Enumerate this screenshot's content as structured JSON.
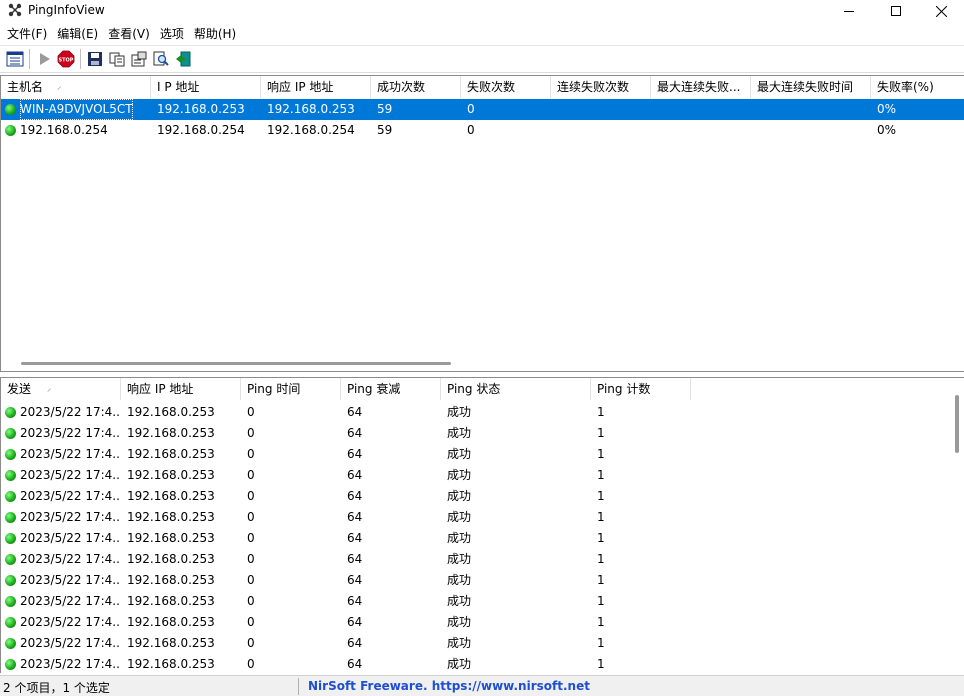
{
  "window": {
    "title": "PingInfoView"
  },
  "menu": [
    "文件(F)",
    "编辑(E)",
    "查看(V)",
    "选项",
    "帮助(H)"
  ],
  "upper": {
    "columns": [
      "主机名",
      "I P 地址",
      "响应 IP 地址",
      "成功次数",
      "失败次数",
      "连续失败次数",
      "最大连续失败...",
      "最大连续失败时间",
      "失败率(%)"
    ],
    "rows": [
      {
        "host": "WIN-A9DVJVOL5CT",
        "ip": "192.168.0.253",
        "reply_ip": "192.168.0.253",
        "succeed": "59",
        "failed": "0",
        "consec_failed": "",
        "max_consec": "",
        "max_consec_time": "",
        "failed_pct": "0%"
      },
      {
        "host": "192.168.0.254",
        "ip": "192.168.0.254",
        "reply_ip": "192.168.0.254",
        "succeed": "59",
        "failed": "0",
        "consec_failed": "",
        "max_consec": "",
        "max_consec_time": "",
        "failed_pct": "0%"
      }
    ]
  },
  "lower": {
    "columns": [
      "发送",
      "响应 IP 地址",
      "Ping 时间",
      "Ping 衰减",
      "Ping 状态",
      "Ping 计数"
    ],
    "rows": [
      {
        "sent": "2023/5/22 17:4...",
        "reply_ip": "192.168.0.253",
        "time": "0",
        "ttl": "64",
        "status": "成功",
        "count": "1"
      },
      {
        "sent": "2023/5/22 17:4...",
        "reply_ip": "192.168.0.253",
        "time": "0",
        "ttl": "64",
        "status": "成功",
        "count": "1"
      },
      {
        "sent": "2023/5/22 17:4...",
        "reply_ip": "192.168.0.253",
        "time": "0",
        "ttl": "64",
        "status": "成功",
        "count": "1"
      },
      {
        "sent": "2023/5/22 17:4...",
        "reply_ip": "192.168.0.253",
        "time": "0",
        "ttl": "64",
        "status": "成功",
        "count": "1"
      },
      {
        "sent": "2023/5/22 17:4...",
        "reply_ip": "192.168.0.253",
        "time": "0",
        "ttl": "64",
        "status": "成功",
        "count": "1"
      },
      {
        "sent": "2023/5/22 17:4...",
        "reply_ip": "192.168.0.253",
        "time": "0",
        "ttl": "64",
        "status": "成功",
        "count": "1"
      },
      {
        "sent": "2023/5/22 17:4...",
        "reply_ip": "192.168.0.253",
        "time": "0",
        "ttl": "64",
        "status": "成功",
        "count": "1"
      },
      {
        "sent": "2023/5/22 17:4...",
        "reply_ip": "192.168.0.253",
        "time": "0",
        "ttl": "64",
        "status": "成功",
        "count": "1"
      },
      {
        "sent": "2023/5/22 17:4...",
        "reply_ip": "192.168.0.253",
        "time": "0",
        "ttl": "64",
        "status": "成功",
        "count": "1"
      },
      {
        "sent": "2023/5/22 17:4...",
        "reply_ip": "192.168.0.253",
        "time": "0",
        "ttl": "64",
        "status": "成功",
        "count": "1"
      },
      {
        "sent": "2023/5/22 17:4...",
        "reply_ip": "192.168.0.253",
        "time": "0",
        "ttl": "64",
        "status": "成功",
        "count": "1"
      },
      {
        "sent": "2023/5/22 17:4...",
        "reply_ip": "192.168.0.253",
        "time": "0",
        "ttl": "64",
        "status": "成功",
        "count": "1"
      },
      {
        "sent": "2023/5/22 17:4...",
        "reply_ip": "192.168.0.253",
        "time": "0",
        "ttl": "64",
        "status": "成功",
        "count": "1"
      }
    ]
  },
  "status": {
    "left": "2 个项目，1 个选定",
    "right": "NirSoft Freeware. https://www.nirsoft.net"
  },
  "colors": {
    "selection": "#0078d7",
    "status_ok": "#1aa51a",
    "stop": "#d0021b",
    "link": "#1f4fd1"
  }
}
